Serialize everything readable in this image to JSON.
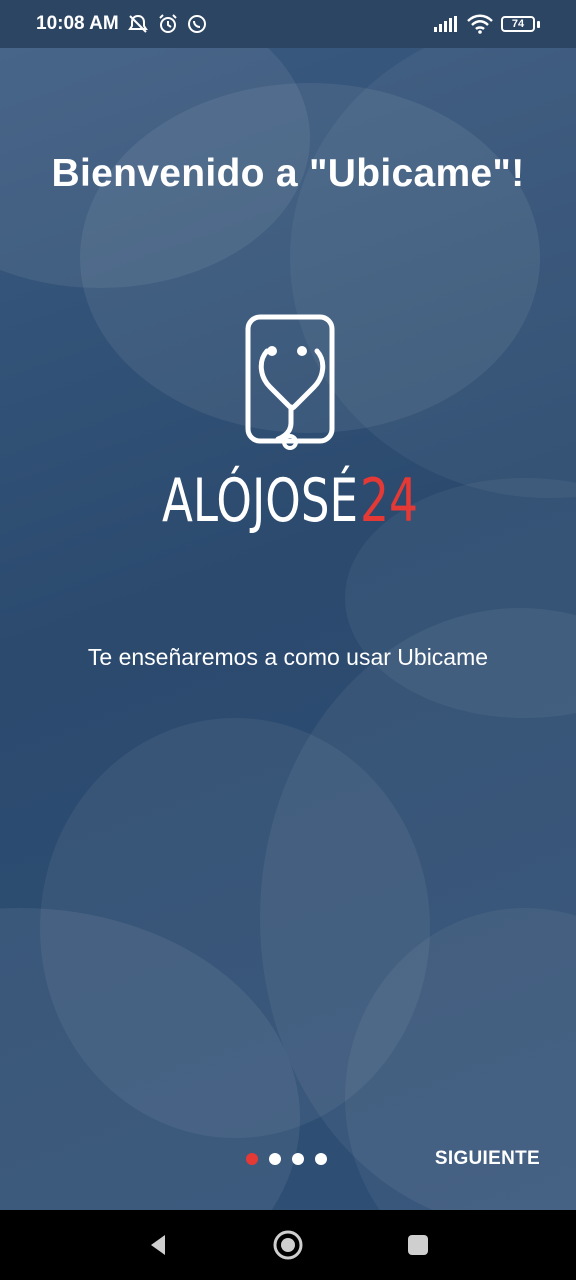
{
  "status_bar": {
    "time": "10:08 AM",
    "left_icons": [
      "mute-icon",
      "alarm-icon",
      "whatsapp-icon"
    ],
    "right_icons": [
      "signal-icon",
      "wifi-icon"
    ],
    "battery_level": "74"
  },
  "welcome": {
    "title": "Bienvenido a \"Ubicame\"!",
    "logo_text_main": "ALÓJOSÉ",
    "logo_text_accent": "24",
    "subtitle": "Te enseñaremos a como usar Ubicame"
  },
  "pager": {
    "total_pages": 4,
    "active_index": 0,
    "next_label": "SIGUIENTE"
  },
  "colors": {
    "background": "#2b4a6e",
    "accent": "#e53935",
    "text": "#ffffff"
  },
  "nav_bar": {
    "buttons": [
      "back-icon",
      "home-icon",
      "recents-icon"
    ]
  }
}
